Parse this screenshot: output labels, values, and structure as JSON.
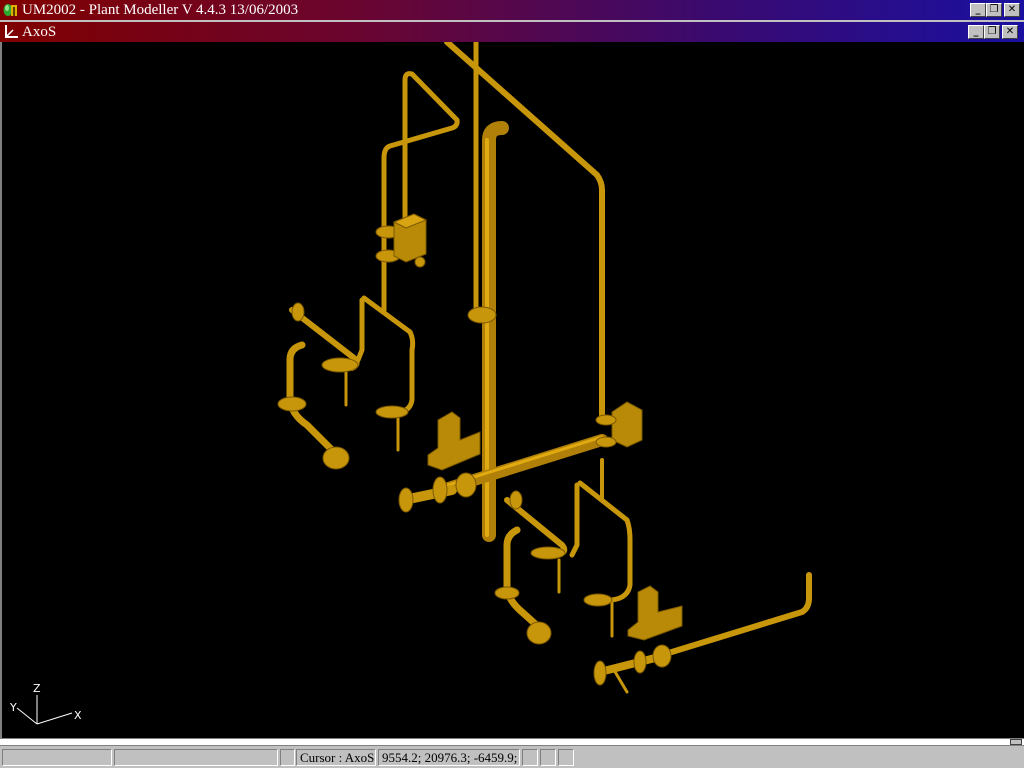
{
  "app": {
    "title": "UM2002 - Plant Modeller V 4.4.3 13/06/2003",
    "icon": "app-logo-icon",
    "controls": {
      "minimize": "_",
      "restore": "❐",
      "close": "✕"
    }
  },
  "document_window": {
    "title": "AxoS",
    "icon": "axes-icon",
    "controls": {
      "minimize": "_",
      "restore": "❐",
      "close": "✕"
    }
  },
  "viewport": {
    "background": "#000000",
    "pipe_color": "#c8960a",
    "axis_triad": {
      "x_label": "X",
      "y_label": "Y",
      "z_label": "Z"
    }
  },
  "statusbar": {
    "panes": [
      {
        "id": "pane1",
        "text": ""
      },
      {
        "id": "pane2",
        "text": ""
      },
      {
        "id": "pane3",
        "text": ""
      },
      {
        "id": "cursor_mode",
        "text": "Cursor : AxoS"
      },
      {
        "id": "coordinates",
        "text": "9554.2; 20976.3; -6459.9;"
      },
      {
        "id": "pane6",
        "text": ""
      },
      {
        "id": "pane7",
        "text": ""
      },
      {
        "id": "pane8",
        "text": ""
      }
    ]
  }
}
